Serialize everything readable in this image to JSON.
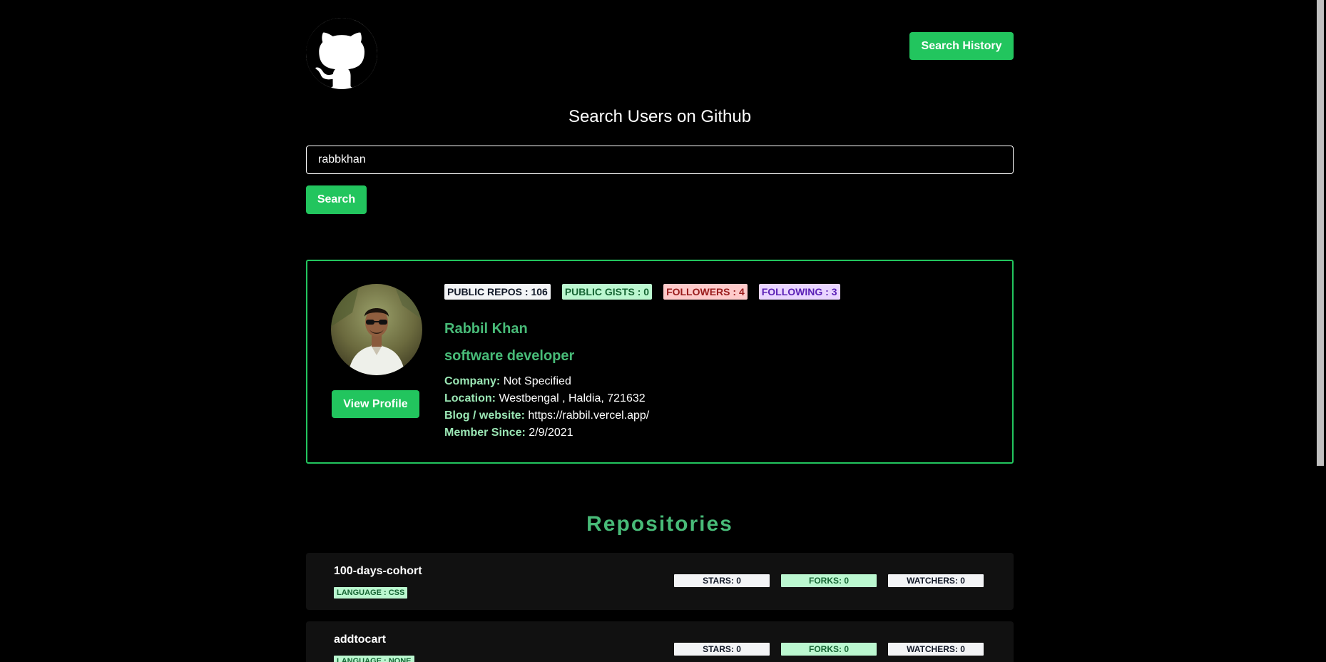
{
  "header": {
    "history_label": "Search History"
  },
  "search": {
    "title": "Search Users on Github",
    "value": "rabbkhan",
    "button_label": "Search"
  },
  "profile": {
    "badges": {
      "repos": "PUBLIC REPOS : 106",
      "gists": "PUBLIC GISTS : 0",
      "followers": "FOLLOWERS : 4",
      "following": "FOLLOWING : 3"
    },
    "name": "Rabbil Khan",
    "bio": "software developer",
    "view_label": "View Profile",
    "company_label": "Company:",
    "company": "Not Specified",
    "location_label": "Location:",
    "location": "Westbengal , Haldia, 721632",
    "blog_label": "Blog / website:",
    "blog": "https://rabbil.vercel.app/",
    "member_label": "Member Since:",
    "member": "2/9/2021"
  },
  "repos": {
    "title": "Repositories",
    "items": [
      {
        "name": "100-days-cohort",
        "language": "LANGUAGE : CSS",
        "stars": "STARS: 0",
        "forks": "FORKS: 0",
        "watchers": "WATCHERS: 0"
      },
      {
        "name": "addtocart",
        "language": "LANGUAGE : NONE",
        "stars": "STARS: 0",
        "forks": "FORKS: 0",
        "watchers": "WATCHERS: 0"
      }
    ]
  },
  "colors": {
    "accent": "#22c55e",
    "heading_green": "#48bb78"
  }
}
